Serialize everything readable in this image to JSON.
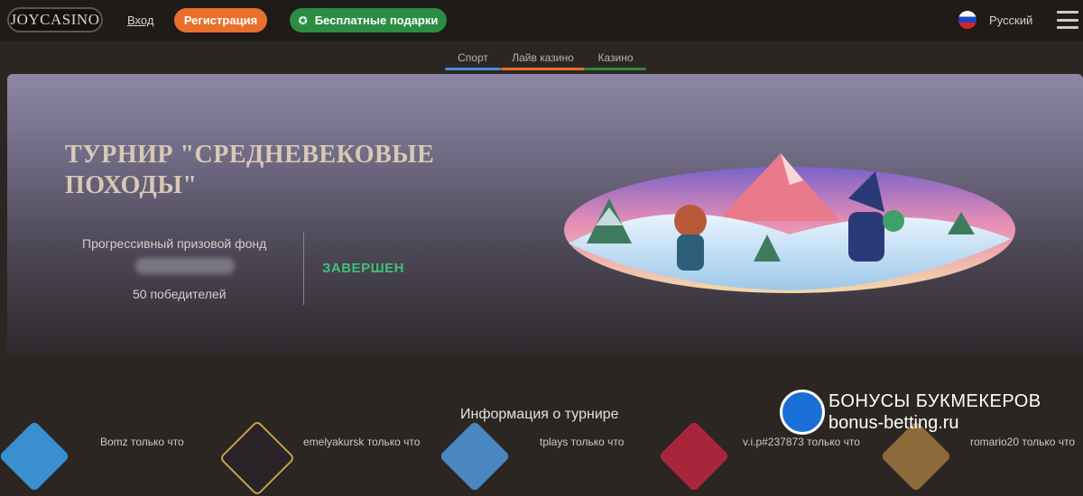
{
  "header": {
    "logo": "JOYCASINO",
    "login": "Вход",
    "register": "Регистрация",
    "gifts": "Бесплатные подарки",
    "language": "Русский",
    "icons": {
      "gift": "gift-icon",
      "flag": "russia-flag-icon",
      "menu": "hamburger-menu-icon"
    }
  },
  "subnav": {
    "tabs": [
      {
        "label": "Спорт",
        "color": "#4a90d9"
      },
      {
        "label": "Лайв казино",
        "color": "#e8702a"
      },
      {
        "label": "Казино",
        "color": "#2b8d42"
      }
    ]
  },
  "banner": {
    "title": "ТУРНИР \"СРЕДНЕВЕКОВЫЕ ПОХОДЫ\"",
    "prize_label": "Прогрессивный призовой фонд",
    "winners": "50 победителей",
    "status": "ЗАВЕРШЕН"
  },
  "info": {
    "title": "Информация о турнире",
    "winners": [
      {
        "text": "Bomz только что"
      },
      {
        "text": "emelyakursk только что"
      },
      {
        "text": "tplays только что"
      },
      {
        "text": "v.i.p#237873 только что"
      },
      {
        "text": "romario20 только что"
      }
    ]
  },
  "watermark": {
    "line1": "БОНУСЫ БУКМЕКЕРОВ",
    "line2": "bonus-betting.ru"
  },
  "colors": {
    "accent_orange": "#e8702a",
    "accent_green": "#2b8d42",
    "status_green": "#3fc07a"
  }
}
